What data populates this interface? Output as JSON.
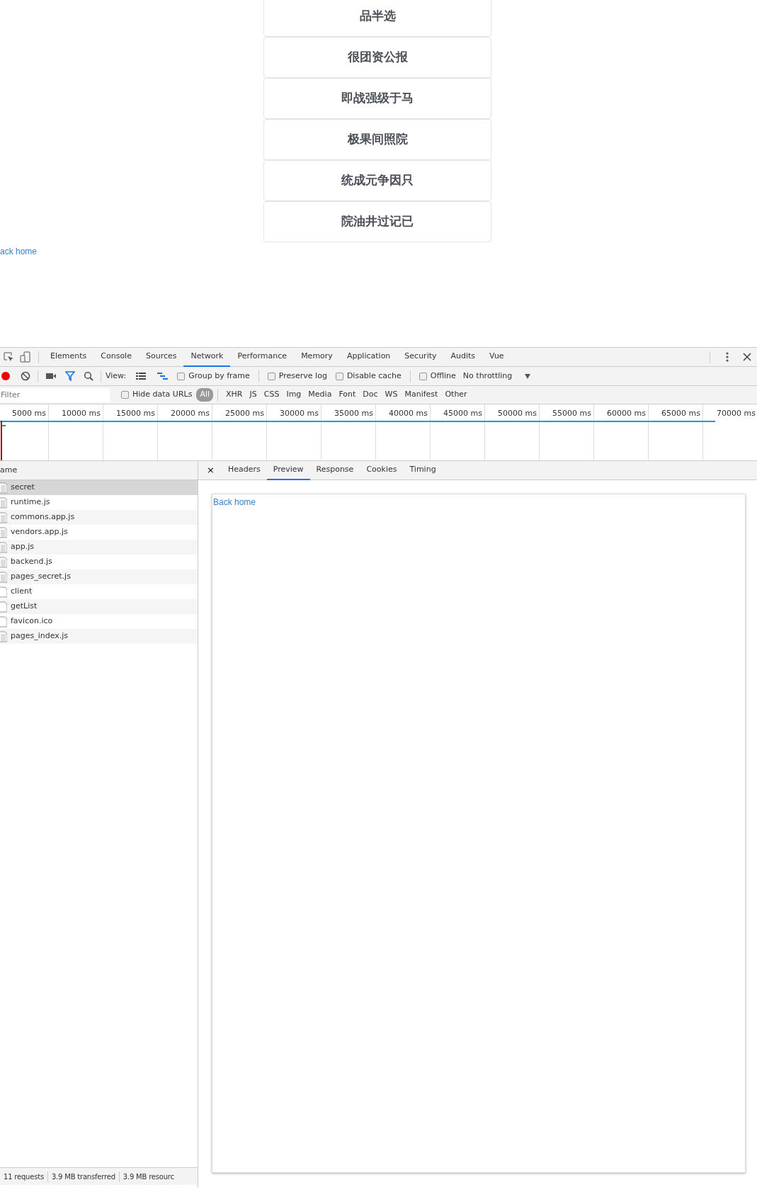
{
  "page": {
    "cards": [
      "品半选",
      "很团资公报",
      "即战强级于马",
      "极果间照院",
      "统成元争因只",
      "院油井过记已"
    ],
    "back_link": "ack home"
  },
  "devtools": {
    "tabs": [
      {
        "label": "Elements",
        "selected": false
      },
      {
        "label": "Console",
        "selected": false
      },
      {
        "label": "Sources",
        "selected": false
      },
      {
        "label": "Network",
        "selected": true
      },
      {
        "label": "Performance",
        "selected": false
      },
      {
        "label": "Memory",
        "selected": false
      },
      {
        "label": "Application",
        "selected": false
      },
      {
        "label": "Security",
        "selected": false
      },
      {
        "label": "Audits",
        "selected": false
      },
      {
        "label": "Vue",
        "selected": false
      }
    ],
    "toolbar": {
      "recording": true,
      "filter_on": true,
      "view_label": "View:",
      "view_options": [
        {
          "kind": "list",
          "selected": false
        },
        {
          "kind": "waterfall",
          "selected": true
        }
      ],
      "options": [
        {
          "label": "Group by frame",
          "checked": false
        },
        {
          "label": "Preserve log",
          "checked": false
        },
        {
          "label": "Disable cache",
          "checked": false
        },
        {
          "label": "Offline",
          "checked": false
        }
      ],
      "throttling": "No throttling"
    },
    "filter_bar": {
      "placeholder": "Filter",
      "hide_data_urls": {
        "label": "Hide data URLs",
        "checked": false
      },
      "types": [
        {
          "label": "All",
          "selected": true
        },
        {
          "label": "XHR",
          "selected": false
        },
        {
          "label": "JS",
          "selected": false
        },
        {
          "label": "CSS",
          "selected": false
        },
        {
          "label": "Img",
          "selected": false
        },
        {
          "label": "Media",
          "selected": false
        },
        {
          "label": "Font",
          "selected": false
        },
        {
          "label": "Doc",
          "selected": false
        },
        {
          "label": "WS",
          "selected": false
        },
        {
          "label": "Manifest",
          "selected": false
        },
        {
          "label": "Other",
          "selected": false
        }
      ]
    },
    "timeline_ticks": [
      "5000 ms",
      "10000 ms",
      "15000 ms",
      "20000 ms",
      "25000 ms",
      "30000 ms",
      "35000 ms",
      "40000 ms",
      "45000 ms",
      "50000 ms",
      "55000 ms",
      "60000 ms",
      "65000 ms",
      "70000 ms"
    ],
    "name_header": "ame",
    "requests": [
      {
        "name": "secret",
        "kind": "lined",
        "selected": true
      },
      {
        "name": "runtime.js",
        "kind": "lined",
        "selected": false
      },
      {
        "name": "commons.app.js",
        "kind": "lined",
        "selected": false
      },
      {
        "name": "vendors.app.js",
        "kind": "lined",
        "selected": false
      },
      {
        "name": "app.js",
        "kind": "lined",
        "selected": false
      },
      {
        "name": "backend.js",
        "kind": "lined",
        "selected": false
      },
      {
        "name": "pages_secret.js",
        "kind": "lined",
        "selected": false
      },
      {
        "name": "client",
        "kind": "blank",
        "selected": false
      },
      {
        "name": "getList",
        "kind": "blank",
        "selected": false
      },
      {
        "name": "favicon.ico",
        "kind": "blank",
        "selected": false
      },
      {
        "name": "pages_index.js",
        "kind": "lined",
        "selected": false
      }
    ],
    "detail_close": "×",
    "detail_tabs": [
      {
        "label": "Headers",
        "selected": false
      },
      {
        "label": "Preview",
        "selected": true
      },
      {
        "label": "Response",
        "selected": false
      },
      {
        "label": "Cookies",
        "selected": false
      },
      {
        "label": "Timing",
        "selected": false
      }
    ],
    "preview_link": "Back home",
    "status_bar": [
      "11 requests",
      "3.9 MB transferred",
      "3.9 MB resourc"
    ]
  }
}
